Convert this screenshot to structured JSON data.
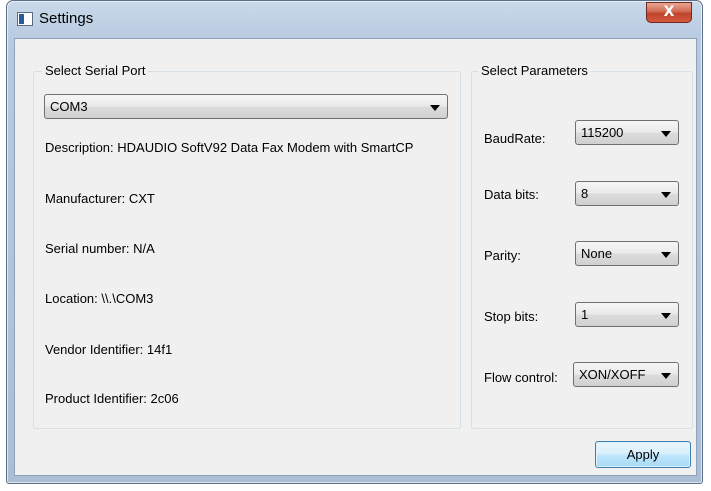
{
  "window": {
    "title": "Settings",
    "close_glyph": "X"
  },
  "serial_port": {
    "group_title": "Select Serial Port",
    "port": "COM3",
    "description": "Description: HDAUDIO SoftV92 Data Fax Modem with SmartCP",
    "manufacturer": "Manufacturer: CXT",
    "serial_number": "Serial number: N/A",
    "location": "Location: \\\\.\\COM3",
    "vendor_id": "Vendor Identifier: 14f1",
    "product_id": "Product Identifier: 2c06"
  },
  "parameters": {
    "group_title": "Select Parameters",
    "baud_rate": {
      "label": "BaudRate:",
      "value": "115200"
    },
    "data_bits": {
      "label": "Data bits:",
      "value": "8"
    },
    "parity": {
      "label": "Parity:",
      "value": "None"
    },
    "stop_bits": {
      "label": "Stop bits:",
      "value": "1"
    },
    "flow_control": {
      "label": "Flow control:",
      "value": "XON/XOFF"
    }
  },
  "apply_label": "Apply"
}
